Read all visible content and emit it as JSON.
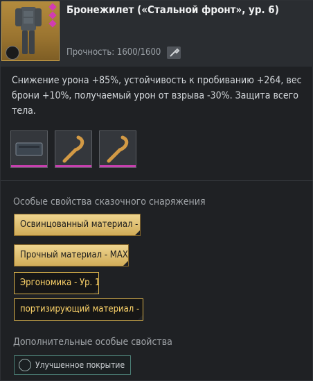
{
  "item": {
    "title": "Бронежилет («Стальной фронт», ур. 6)",
    "durability": "Прочность: 1600/1600"
  },
  "description": "Снижение урона +85%, устойчивость к пробиванию +264, вес брони +10%, получаемый урон от взрыва -30%. Защита всего тела.",
  "mod_slots": [
    "case-icon",
    "rope-icon",
    "rope-icon"
  ],
  "legendary": {
    "title": "Особые свойства сказочного снаряжения",
    "props": [
      {
        "label": "Освинцованный материал - M",
        "style": "gold"
      },
      {
        "label": "Прочный материал - MAX",
        "style": "gold"
      },
      {
        "label": "Эргономика - Ур. 1",
        "style": "dark"
      },
      {
        "label": "портизирующий материал - Ь",
        "style": "dark"
      }
    ]
  },
  "extra": {
    "title": "Дополнительные особые свойства",
    "items": [
      {
        "label": "Улучшенное покрытие"
      }
    ]
  },
  "colors": {
    "rarity": "#c93fb0",
    "gold": "#d9b14c"
  }
}
